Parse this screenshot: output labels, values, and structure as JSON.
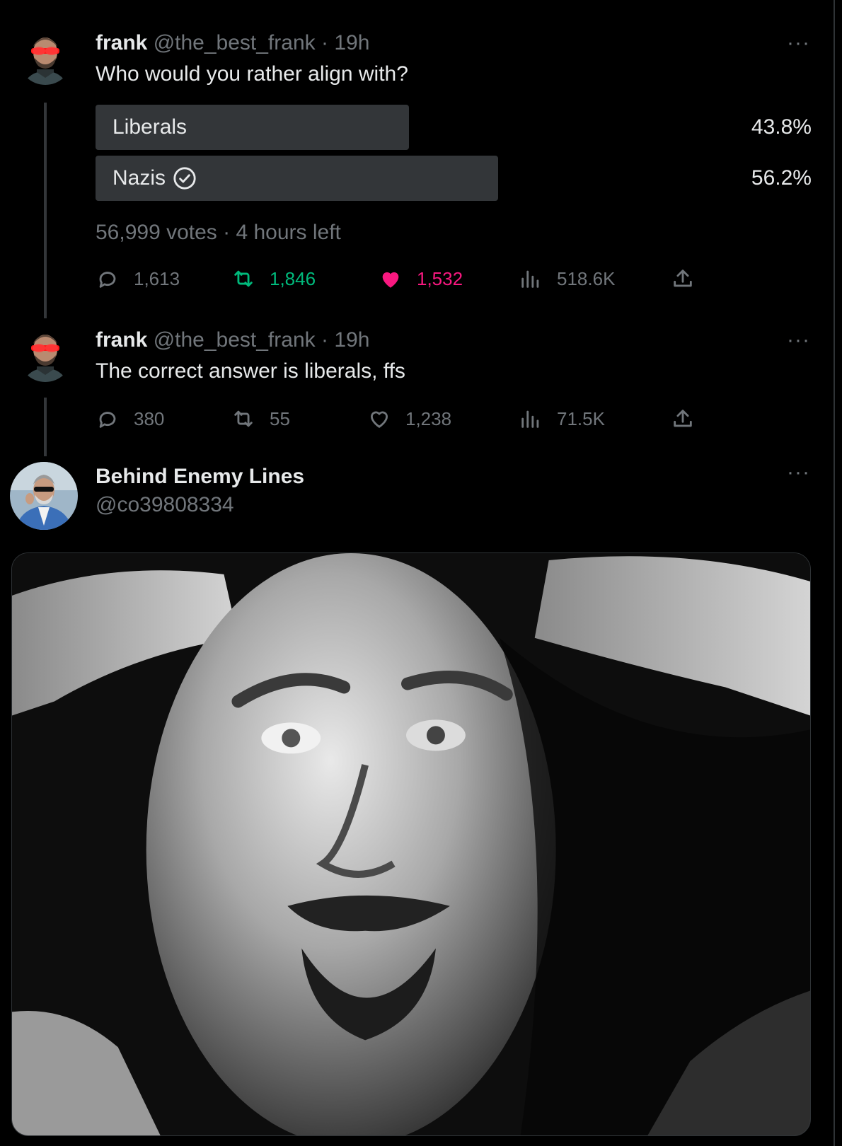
{
  "colors": {
    "background": "#000000",
    "text_primary": "#e7e9ea",
    "text_secondary": "#71767b",
    "poll_bar": "#333639",
    "retweet_active": "#00ba7c",
    "like_active": "#f91880"
  },
  "tweets": [
    {
      "author": {
        "name": "frank",
        "handle": "@the_best_frank",
        "separator": "·",
        "time": "19h"
      },
      "text": "Who would you rather align with?",
      "poll": {
        "options": [
          {
            "label": "Liberals",
            "percent": "43.8%",
            "fraction": 0.438,
            "icon": null
          },
          {
            "label": "Nazis",
            "percent": "56.2%",
            "fraction": 0.562,
            "icon": "check-circle-icon"
          }
        ],
        "meta": "56,999 votes · 4 hours left"
      },
      "actions": {
        "replies": "1,613",
        "retweets": "1,846",
        "likes": "1,532",
        "views": "518.6K",
        "retweeted": true,
        "liked": true
      }
    },
    {
      "author": {
        "name": "frank",
        "handle": "@the_best_frank",
        "separator": "·",
        "time": "19h"
      },
      "text": "The correct answer is liberals, ffs",
      "actions": {
        "replies": "380",
        "retweets": "55",
        "likes": "1,238",
        "views": "71.5K",
        "retweeted": false,
        "liked": false
      }
    },
    {
      "author": {
        "name": "Behind Enemy Lines",
        "handle": "@co39808334"
      },
      "media": {
        "kind": "photo",
        "style": "black-and-white portrait"
      }
    }
  ],
  "icons": {
    "more": "more-icon",
    "reply": "reply-icon",
    "retweet": "retweet-icon",
    "like": "heart-icon",
    "views": "views-icon",
    "share": "share-icon"
  },
  "more_glyph": "···"
}
